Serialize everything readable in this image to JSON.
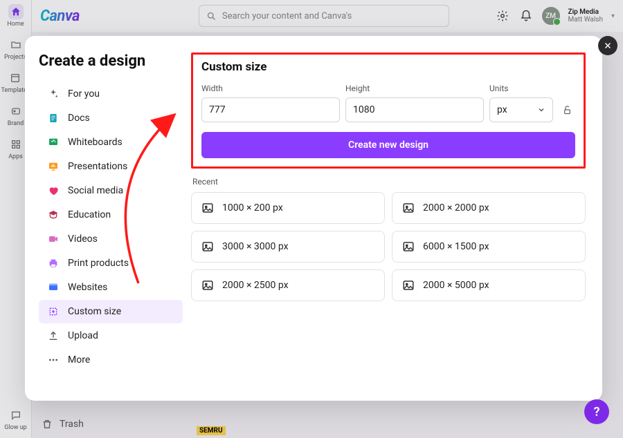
{
  "header": {
    "logo_text": "Canva",
    "search_placeholder": "Search your content and Canva's",
    "user_team": "Zip Media",
    "user_name": "Matt Walsh",
    "avatar_initials": "ZM"
  },
  "rail": {
    "items": [
      {
        "label": "Home",
        "icon": "home"
      },
      {
        "label": "Projects",
        "icon": "folder"
      },
      {
        "label": "Templates",
        "icon": "template"
      },
      {
        "label": "Brand",
        "icon": "brand"
      },
      {
        "label": "Apps",
        "icon": "apps"
      }
    ],
    "bottom": {
      "label": "Glow up",
      "icon": "chat"
    }
  },
  "background": {
    "trash_label": "Trash",
    "semru_badge": "SEMRU"
  },
  "modal": {
    "title": "Create a design",
    "menu": [
      {
        "label": "For you",
        "icon": "sparkle",
        "color": "#555"
      },
      {
        "label": "Docs",
        "icon": "doc",
        "color": "#13a3b5"
      },
      {
        "label": "Whiteboards",
        "icon": "whiteboard",
        "color": "#18a35a"
      },
      {
        "label": "Presentations",
        "icon": "presentation",
        "color": "#ff9a1f"
      },
      {
        "label": "Social media",
        "icon": "social",
        "color": "#e8346c"
      },
      {
        "label": "Education",
        "icon": "education",
        "color": "#b83250"
      },
      {
        "label": "Videos",
        "icon": "video",
        "color": "#d96bc6"
      },
      {
        "label": "Print products",
        "icon": "print",
        "color": "#b266ff"
      },
      {
        "label": "Websites",
        "icon": "website",
        "color": "#3b6fff"
      },
      {
        "label": "Custom size",
        "icon": "customsize",
        "color": "#8b3dff",
        "selected": true
      },
      {
        "label": "Upload",
        "icon": "upload",
        "color": "#555"
      },
      {
        "label": "More",
        "icon": "more",
        "color": "#555"
      }
    ],
    "custom_size": {
      "title": "Custom size",
      "width_label": "Width",
      "height_label": "Height",
      "units_label": "Units",
      "width_value": "777",
      "height_value": "1080",
      "units_value": "px",
      "create_button": "Create new design"
    },
    "recent": {
      "label": "Recent",
      "items": [
        {
          "label": "1000 × 200 px"
        },
        {
          "label": "2000 × 2000 px"
        },
        {
          "label": "3000 × 3000 px"
        },
        {
          "label": "6000 × 1500 px"
        },
        {
          "label": "2000 × 2500 px"
        },
        {
          "label": "2000 × 5000 px"
        }
      ]
    }
  },
  "help_fab": "?"
}
